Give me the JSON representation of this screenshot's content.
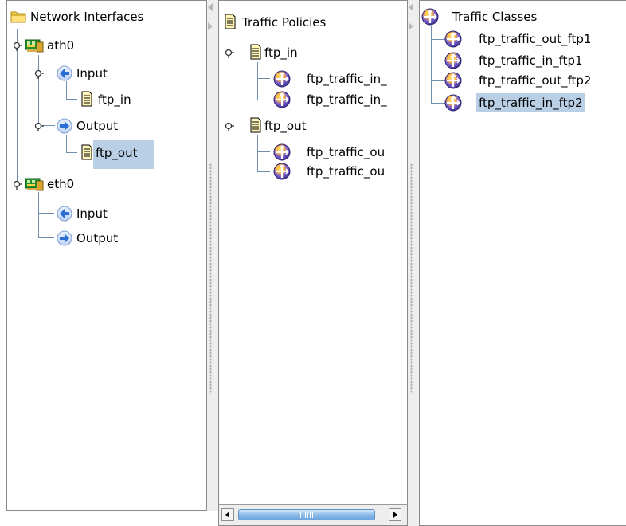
{
  "panes": {
    "interfaces": {
      "title": "Network Interfaces",
      "ath0": {
        "label": "ath0",
        "input": "Input",
        "input_policy": "ftp_in",
        "output": "Output",
        "output_policy": "ftp_out"
      },
      "eth0": {
        "label": "eth0",
        "input": "Input",
        "output": "Output"
      }
    },
    "policies": {
      "title": "Traffic Policies",
      "ftp_in": {
        "label": "ftp_in",
        "children": [
          "ftp_traffic_in_",
          "ftp_traffic_in_"
        ]
      },
      "ftp_out": {
        "label": "ftp_out",
        "children": [
          "ftp_traffic_ou",
          "ftp_traffic_ou"
        ]
      }
    },
    "classes": {
      "title": "Traffic Classes",
      "items": [
        "ftp_traffic_out_ftp1",
        "ftp_traffic_in_ftp1",
        "ftp_traffic_out_ftp2",
        "ftp_traffic_in_ftp2"
      ]
    }
  },
  "selection": {
    "interfaces": "ftp_out",
    "classes": "ftp_traffic_in_ftp2"
  },
  "colors": {
    "selection": "#b8cfe5",
    "tree_line": "#6f8fb0",
    "arrow_blue": "#2a6fd6",
    "scroll_thumb": "#8cbbe9"
  },
  "icons": {
    "root_interfaces": "folder-icon",
    "interface": "network-card-icon",
    "input": "arrow-left-icon",
    "output": "arrow-right-icon",
    "policy": "document-icon",
    "traffic_class": "globe-icon"
  }
}
